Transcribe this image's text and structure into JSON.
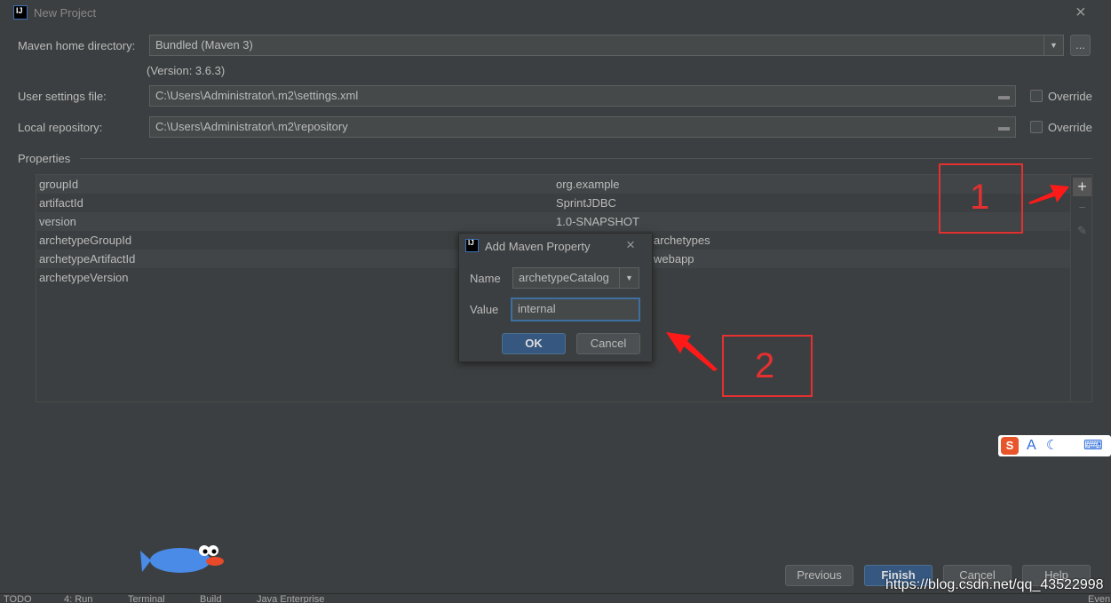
{
  "window": {
    "title": "New Project",
    "close": "×"
  },
  "maven_home": {
    "label": "Maven home directory:",
    "value": "Bundled (Maven 3)",
    "browse": "...",
    "version": "(Version: 3.6.3)"
  },
  "user_settings": {
    "label": "User settings file:",
    "value": "C:\\Users\\Administrator\\.m2\\settings.xml",
    "override": "Override"
  },
  "local_repo": {
    "label": "Local repository:",
    "value": "C:\\Users\\Administrator\\.m2\\repository",
    "override": "Override"
  },
  "properties": {
    "label": "Properties",
    "rows": [
      {
        "key": "groupId",
        "value": "org.example"
      },
      {
        "key": "artifactId",
        "value": "SprintJDBC"
      },
      {
        "key": "version",
        "value": "1.0-SNAPSHOT"
      },
      {
        "key": "archetypeGroupId",
        "value": "archetypes"
      },
      {
        "key": "archetypeArtifactId",
        "value": "webapp"
      },
      {
        "key": "archetypeVersion",
        "value": ""
      }
    ]
  },
  "dialog": {
    "title": "Add Maven Property",
    "name_label": "Name",
    "name_value": "archetypeCatalog",
    "value_label": "Value",
    "value_value": "internal",
    "ok": "OK",
    "cancel": "Cancel"
  },
  "annotations": {
    "one": "1",
    "two": "2",
    "color": "#ff2020"
  },
  "footer": {
    "previous": "Previous",
    "finish": "Finish",
    "cancel": "Cancel",
    "help": "Help"
  },
  "watermark": "https://blog.csdn.net/qq_43522998",
  "taskbar": [
    "TODO",
    "4: Run",
    "Terminal",
    "Build",
    "Java Enterprise"
  ],
  "taskbar_right": "Even",
  "ime": {
    "s": "S",
    "a": "A"
  }
}
